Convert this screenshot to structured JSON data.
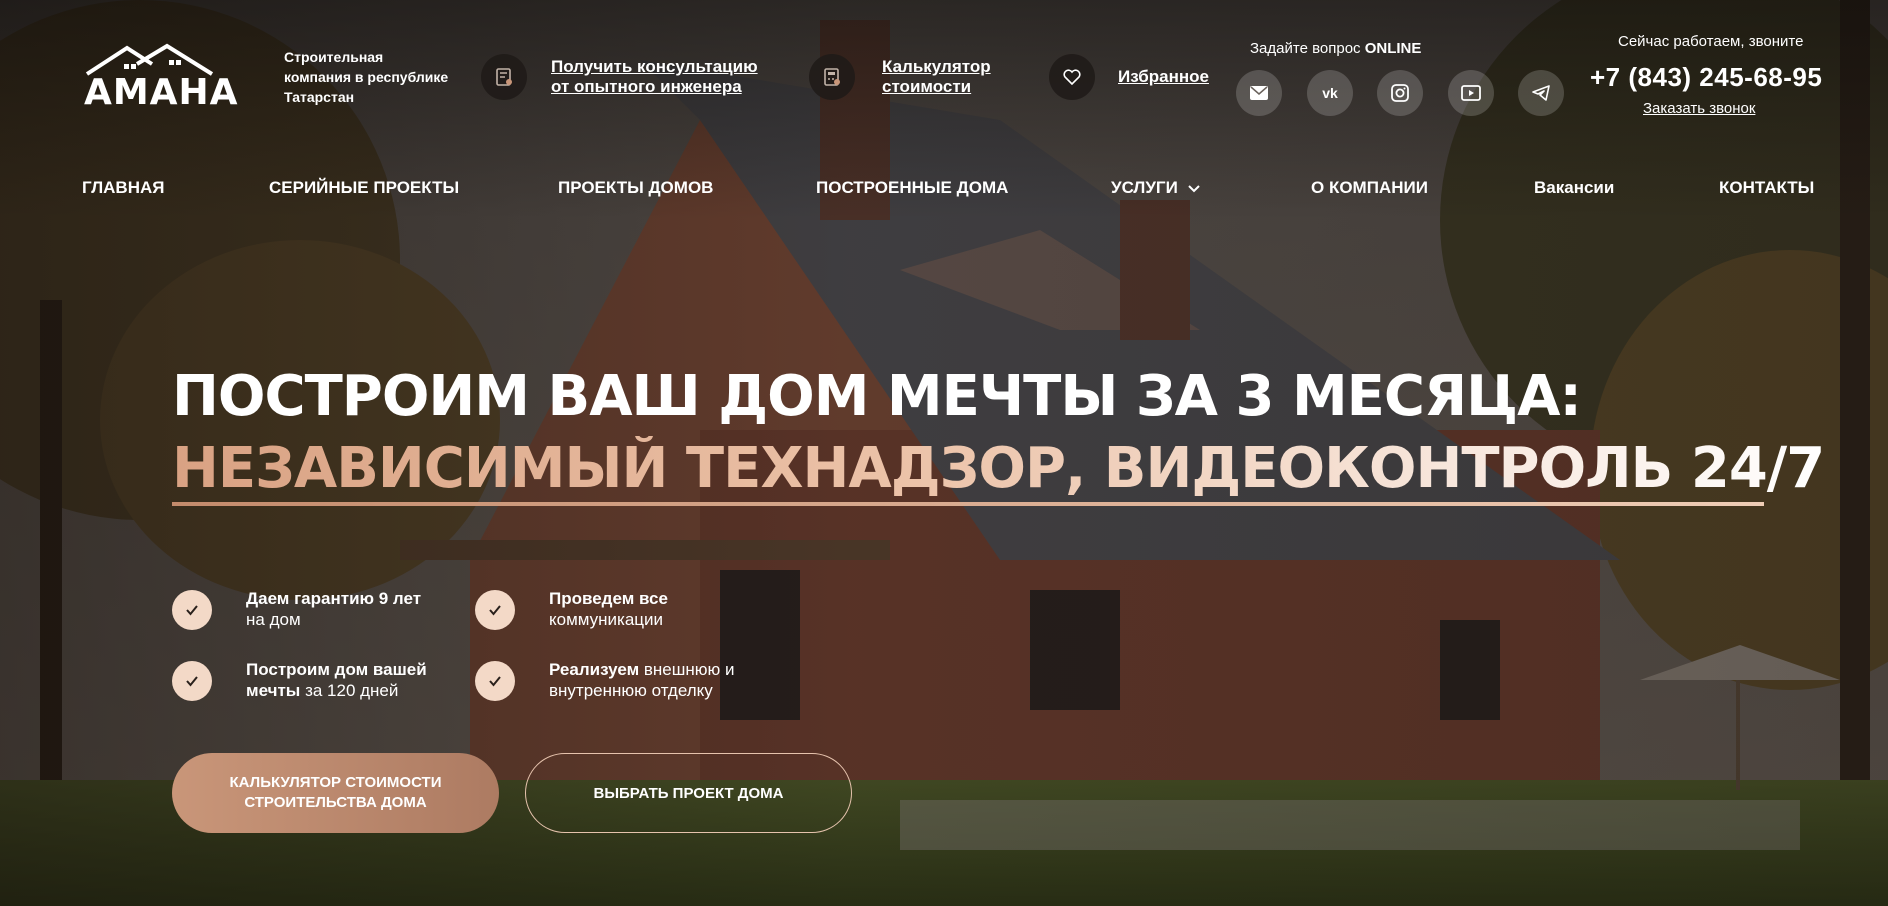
{
  "brand": {
    "logo_text": "АМАНА",
    "tagline": "Строительная компания в республике Татарстан"
  },
  "header": {
    "consult_link": "Получить консультацию от опытного инженера",
    "calc_link": "Калькулятор стоимости",
    "favorites_link": "Избранное",
    "ask_prefix": "Задайте вопрос",
    "ask_strong": "ONLINE",
    "working_text": "Сейчас работаем, звоните",
    "phone": "+7 (843) 245-68-95",
    "callback_link": "Заказать звонок",
    "socials": [
      "mail-icon",
      "vk-icon",
      "instagram-icon",
      "youtube-icon",
      "telegram-icon"
    ]
  },
  "nav": {
    "items": [
      {
        "label": "ГЛАВНАЯ"
      },
      {
        "label": "СЕРИЙНЫЕ ПРОЕКТЫ"
      },
      {
        "label": "ПРОЕКТЫ ДОМОВ"
      },
      {
        "label": "ПОСТРОЕННЫЕ ДОМА"
      },
      {
        "label": "УСЛУГИ"
      },
      {
        "label": "О КОМПАНИИ"
      },
      {
        "label": "Вакансии"
      },
      {
        "label": "КОНТАКТЫ"
      }
    ]
  },
  "hero": {
    "title_line1": "ПОСТРОИМ ВАШ ДОМ МЕЧТЫ ЗА 3 МЕСЯЦА:",
    "title_line2": "НЕЗАВИСИМЫЙ ТЕХНАДЗОР, ВИДЕОКОНТРОЛЬ 24/7",
    "features": [
      {
        "strong": "Даем гарантию 9 лет",
        "rest": "на дом"
      },
      {
        "strong": "Проведем все",
        "rest": "коммуникации"
      },
      {
        "strong": "Построим дом вашей мечты",
        "rest": "за 120 дней"
      },
      {
        "strong": "Реализуем",
        "rest": "внешнюю и внутреннюю отделку"
      }
    ],
    "cta_primary": "КАЛЬКУЛЯТОР СТОИМОСТИ СТРОИТЕЛЬСТВА ДОМА",
    "cta_secondary": "ВЫБРАТЬ ПРОЕКТ ДОМА"
  },
  "colors": {
    "accent": "#c99679",
    "accent_light": "#f3d9c7",
    "check_icon": "#2a211c"
  }
}
